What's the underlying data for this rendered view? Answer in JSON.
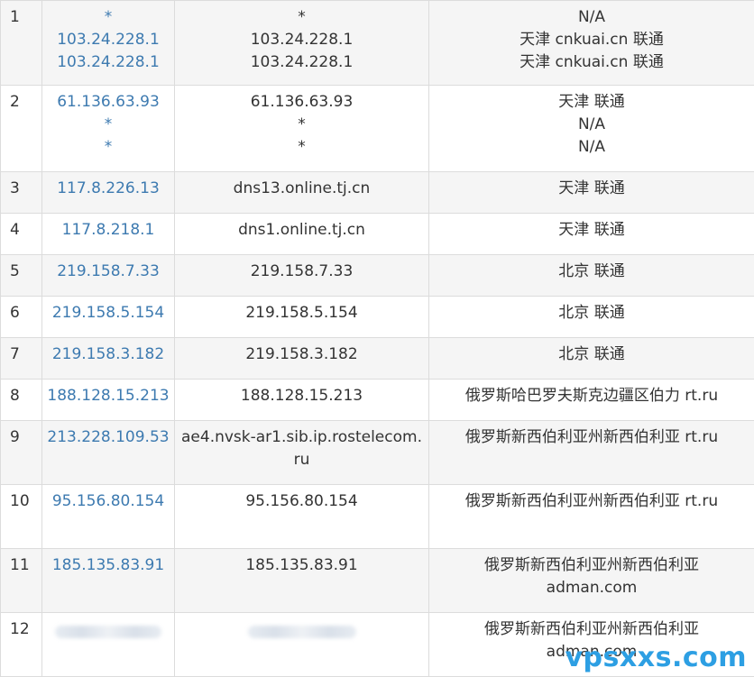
{
  "rows": [
    {
      "num": "1",
      "ips": [
        "*",
        "103.24.228.1",
        "103.24.228.1"
      ],
      "hosts": [
        "*",
        "103.24.228.1",
        "103.24.228.1"
      ],
      "locs": [
        "N/A",
        "天津 cnkuai.cn 联通",
        "天津 cnkuai.cn 联通"
      ]
    },
    {
      "num": "2",
      "ips": [
        "61.136.63.93",
        "*",
        "*"
      ],
      "hosts": [
        "61.136.63.93",
        "*",
        "*"
      ],
      "locs": [
        "天津 联通",
        "N/A",
        "N/A"
      ]
    },
    {
      "num": "3",
      "ips": [
        "117.8.226.13"
      ],
      "hosts": [
        "dns13.online.tj.cn"
      ],
      "locs": [
        "天津 联通"
      ]
    },
    {
      "num": "4",
      "ips": [
        "117.8.218.1"
      ],
      "hosts": [
        "dns1.online.tj.cn"
      ],
      "locs": [
        "天津 联通"
      ]
    },
    {
      "num": "5",
      "ips": [
        "219.158.7.33"
      ],
      "hosts": [
        "219.158.7.33"
      ],
      "locs": [
        "北京 联通"
      ]
    },
    {
      "num": "6",
      "ips": [
        "219.158.5.154"
      ],
      "hosts": [
        "219.158.5.154"
      ],
      "locs": [
        "北京 联通"
      ]
    },
    {
      "num": "7",
      "ips": [
        "219.158.3.182"
      ],
      "hosts": [
        "219.158.3.182"
      ],
      "locs": [
        "北京 联通"
      ]
    },
    {
      "num": "8",
      "ips": [
        "188.128.15.213"
      ],
      "hosts": [
        "188.128.15.213"
      ],
      "locs": [
        "俄罗斯哈巴罗夫斯克边疆区伯力 rt.ru"
      ]
    },
    {
      "num": "9",
      "ips": [
        "213.228.109.53"
      ],
      "hosts": [
        "ae4.nvsk-ar1.sib.ip.rostelecom.ru"
      ],
      "locs": [
        "俄罗斯新西伯利亚州新西伯利亚 rt.ru"
      ]
    },
    {
      "num": "10",
      "ips": [
        "95.156.80.154"
      ],
      "hosts": [
        "95.156.80.154"
      ],
      "locs": [
        "俄罗斯新西伯利亚州新西伯利亚 rt.ru"
      ]
    },
    {
      "num": "11",
      "ips": [
        "185.135.83.91"
      ],
      "hosts": [
        "185.135.83.91"
      ],
      "locs": [
        "俄罗斯新西伯利亚州新西伯利亚",
        "adman.com"
      ]
    },
    {
      "num": "12",
      "ips": [],
      "hosts": [],
      "locs": [
        "俄罗斯新西伯利亚州新西伯利亚",
        "adman.com"
      ]
    }
  ],
  "watermark": "vpsxxs.com"
}
